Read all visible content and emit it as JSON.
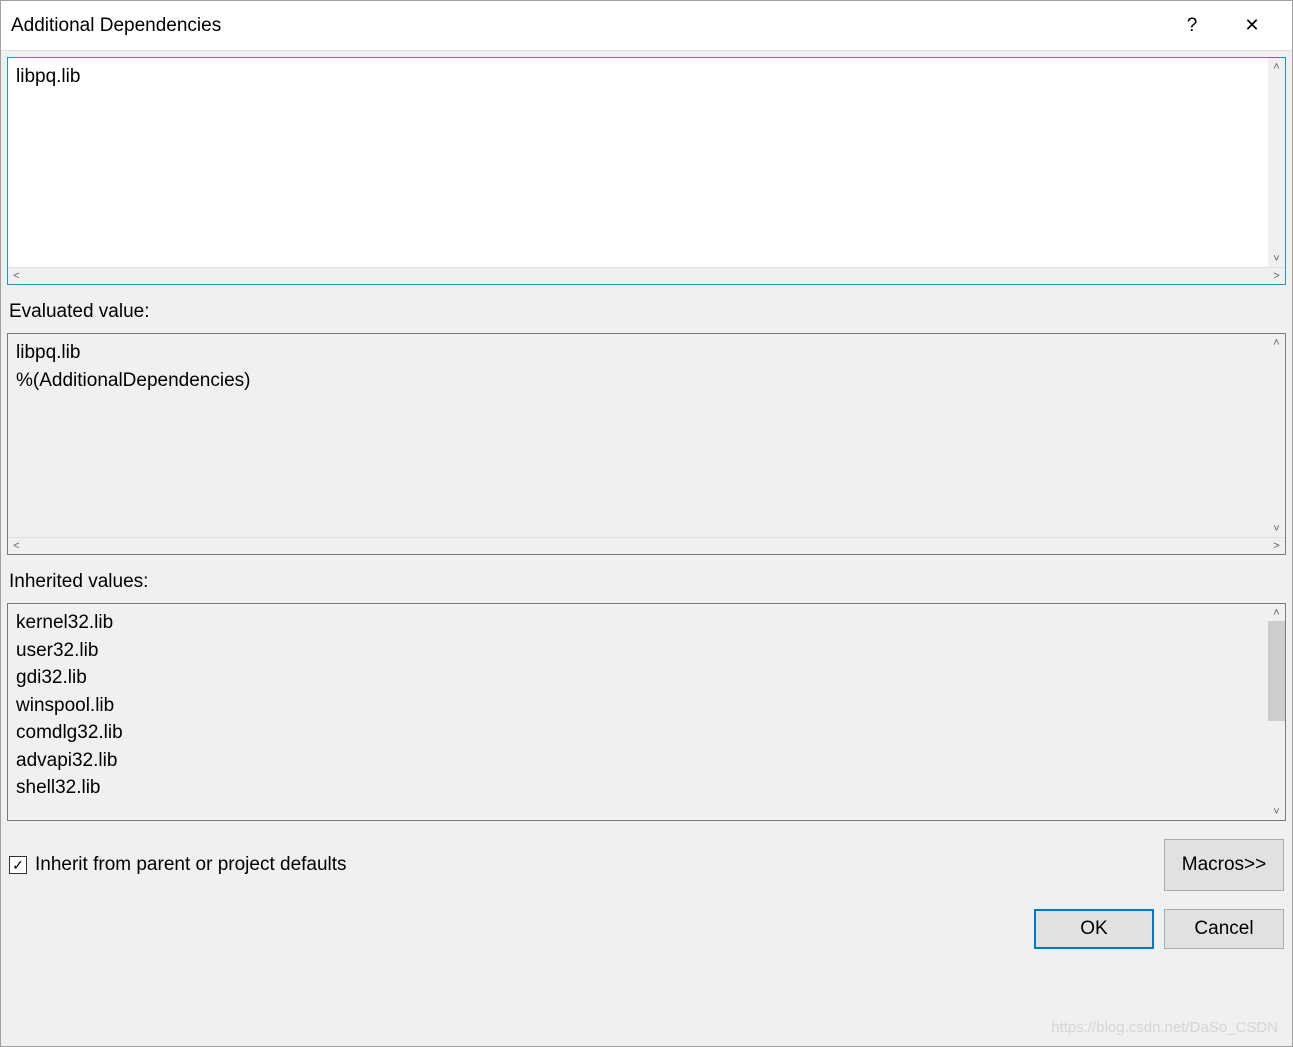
{
  "titlebar": {
    "title": "Additional Dependencies",
    "help_label": "?",
    "close_label": "✕"
  },
  "editor": {
    "value": "libpq.lib"
  },
  "evaluated": {
    "label": "Evaluated value:",
    "value": "libpq.lib\n%(AdditionalDependencies)"
  },
  "inherited": {
    "label": "Inherited values:",
    "value": "kernel32.lib\nuser32.lib\ngdi32.lib\nwinspool.lib\ncomdlg32.lib\nadvapi32.lib\nshell32.lib"
  },
  "checkbox": {
    "checked": true,
    "mark": "✓",
    "label": "Inherit from parent or project defaults"
  },
  "buttons": {
    "macros": "Macros>>",
    "ok": "OK",
    "cancel": "Cancel"
  },
  "scroll": {
    "up": "˄",
    "down": "˅",
    "left": "<",
    "right": ">"
  },
  "watermark": "https://blog.csdn.net/DaSo_CSDN"
}
